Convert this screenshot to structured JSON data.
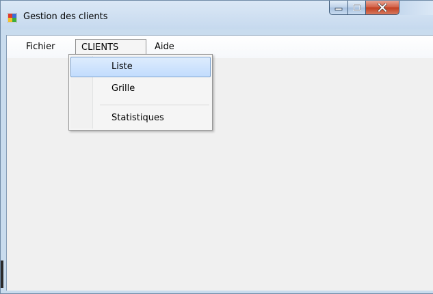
{
  "window": {
    "title": "Gestion des clients",
    "icons": {
      "app": "app-window-icon",
      "minimize": "minimize-icon",
      "maximize": "maximize-icon",
      "close": "close-icon"
    },
    "colors": {
      "title_bar": "#c6d9ee",
      "close_button": "#c23f21",
      "client_area": "#f0f0f0",
      "highlight": "#c2dcfd"
    }
  },
  "menubar": {
    "items": [
      {
        "label": "Fichier"
      },
      {
        "label": "CLIENTS",
        "open": true
      },
      {
        "label": "Aide"
      }
    ]
  },
  "dropdown": {
    "items": [
      {
        "label": "Liste",
        "highlighted": true
      },
      {
        "label": "Grille"
      },
      {
        "label": "Statistiques"
      }
    ]
  }
}
